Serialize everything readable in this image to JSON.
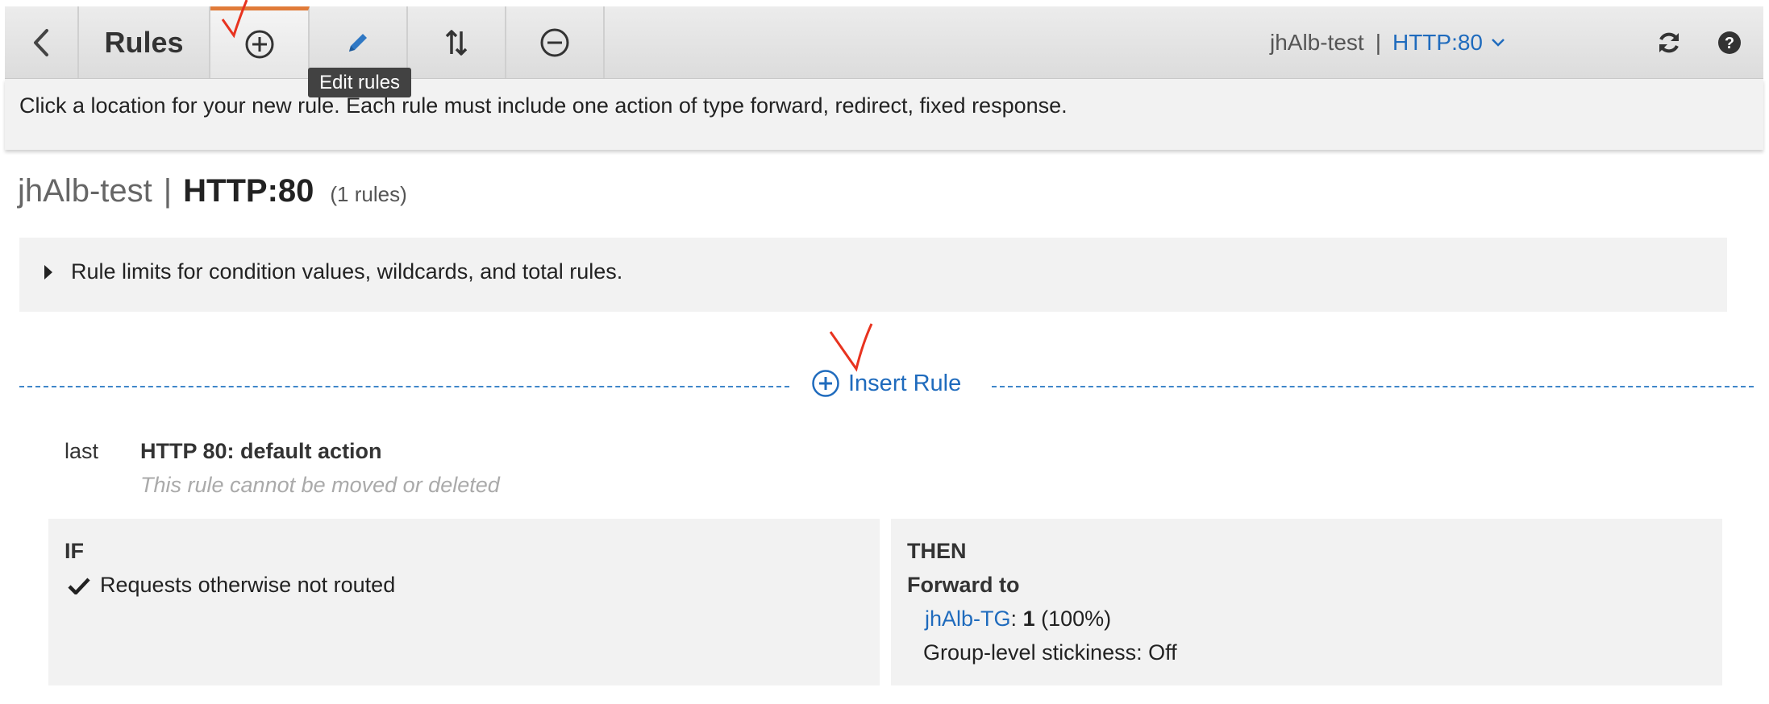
{
  "toolbar": {
    "title": "Rules",
    "tooltip": "Edit rules",
    "load_balancer": "jhAlb-test",
    "separator": "|",
    "listener": "HTTP:80"
  },
  "hint": "Click a location for your new rule. Each rule must include one action of type forward, redirect, fixed response.",
  "heading": {
    "load_balancer": "jhAlb-test",
    "separator": "|",
    "listener": "HTTP:80",
    "count": "(1 rules)"
  },
  "limits_label": "Rule limits for condition values, wildcards, and total rules.",
  "insert_rule_label": "Insert Rule",
  "rule": {
    "priority": "last",
    "name": "HTTP 80: default action",
    "note": "This rule cannot be moved or deleted",
    "if_header": "IF",
    "condition": "Requests otherwise not routed",
    "then_header": "THEN",
    "action": "Forward to",
    "target_group": "jhAlb-TG",
    "weight_sep": ":",
    "weight": "1",
    "weight_pct": "(100%)",
    "stickiness": "Group-level stickiness: Off"
  },
  "colors": {
    "accent_tab": "#e07b39",
    "link": "#1f6bbd",
    "annotation": "#e8331f"
  }
}
